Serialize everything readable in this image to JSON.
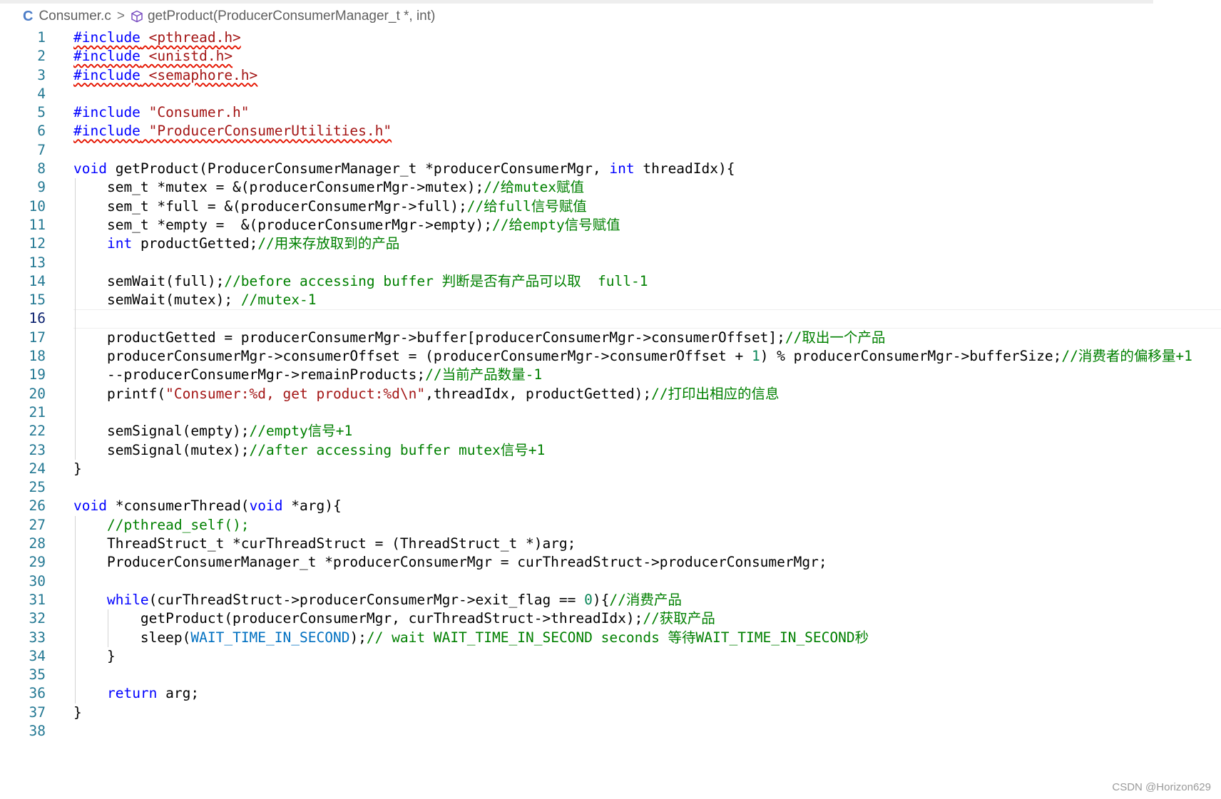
{
  "breadcrumb": {
    "file_icon": "C",
    "file": "Consumer.c",
    "symbol_icon": "cube-icon",
    "symbol": "getProduct(ProducerConsumerManager_t *, int)"
  },
  "active_line": 16,
  "lines": [
    {
      "n": "1",
      "t": "#include <pthread.h>"
    },
    {
      "n": "2",
      "t": "#include <unistd.h>"
    },
    {
      "n": "3",
      "t": "#include <semaphore.h>"
    },
    {
      "n": "4",
      "t": ""
    },
    {
      "n": "5",
      "t": "#include \"Consumer.h\""
    },
    {
      "n": "6",
      "t": "#include \"ProducerConsumerUtilities.h\""
    },
    {
      "n": "7",
      "t": ""
    },
    {
      "n": "8",
      "t": "void getProduct(ProducerConsumerManager_t *producerConsumerMgr, int threadIdx){"
    },
    {
      "n": "9",
      "t": "    sem_t *mutex = &(producerConsumerMgr->mutex);//给mutex赋值"
    },
    {
      "n": "10",
      "t": "    sem_t *full = &(producerConsumerMgr->full);//给full信号赋值"
    },
    {
      "n": "11",
      "t": "    sem_t *empty =  &(producerConsumerMgr->empty);//给empty信号赋值"
    },
    {
      "n": "12",
      "t": "    int productGetted;//用来存放取到的产品"
    },
    {
      "n": "13",
      "t": ""
    },
    {
      "n": "14",
      "t": "    semWait(full);//before accessing buffer 判断是否有产品可以取  full-1"
    },
    {
      "n": "15",
      "t": "    semWait(mutex); //mutex-1"
    },
    {
      "n": "16",
      "t": ""
    },
    {
      "n": "17",
      "t": "    productGetted = producerConsumerMgr->buffer[producerConsumerMgr->consumerOffset];//取出一个产品"
    },
    {
      "n": "18",
      "t": "    producerConsumerMgr->consumerOffset = (producerConsumerMgr->consumerOffset + 1) % producerConsumerMgr->bufferSize;//消费者的偏移量+1"
    },
    {
      "n": "19",
      "t": "    --producerConsumerMgr->remainProducts;//当前产品数量-1"
    },
    {
      "n": "20",
      "t": "    printf(\"Consumer:%d, get product:%d\\n\",threadIdx, productGetted);//打印出相应的信息"
    },
    {
      "n": "21",
      "t": ""
    },
    {
      "n": "22",
      "t": "    semSignal(empty);//empty信号+1"
    },
    {
      "n": "23",
      "t": "    semSignal(mutex);//after accessing buffer mutex信号+1"
    },
    {
      "n": "24",
      "t": "}"
    },
    {
      "n": "25",
      "t": ""
    },
    {
      "n": "26",
      "t": "void *consumerThread(void *arg){"
    },
    {
      "n": "27",
      "t": "    //pthread_self();"
    },
    {
      "n": "28",
      "t": "    ThreadStruct_t *curThreadStruct = (ThreadStruct_t *)arg;"
    },
    {
      "n": "29",
      "t": "    ProducerConsumerManager_t *producerConsumerMgr = curThreadStruct->producerConsumerMgr;"
    },
    {
      "n": "30",
      "t": ""
    },
    {
      "n": "31",
      "t": "    while(curThreadStruct->producerConsumerMgr->exit_flag == 0){//消费产品"
    },
    {
      "n": "32",
      "t": "        getProduct(producerConsumerMgr, curThreadStruct->threadIdx);//获取产品"
    },
    {
      "n": "33",
      "t": "        sleep(WAIT_TIME_IN_SECOND);// wait WAIT_TIME_IN_SECOND seconds 等待WAIT_TIME_IN_SECOND秒"
    },
    {
      "n": "34",
      "t": "    }"
    },
    {
      "n": "35",
      "t": ""
    },
    {
      "n": "36",
      "t": "    return arg;"
    },
    {
      "n": "37",
      "t": "}"
    },
    {
      "n": "38",
      "t": ""
    }
  ],
  "watermark": "CSDN @Horizon629"
}
